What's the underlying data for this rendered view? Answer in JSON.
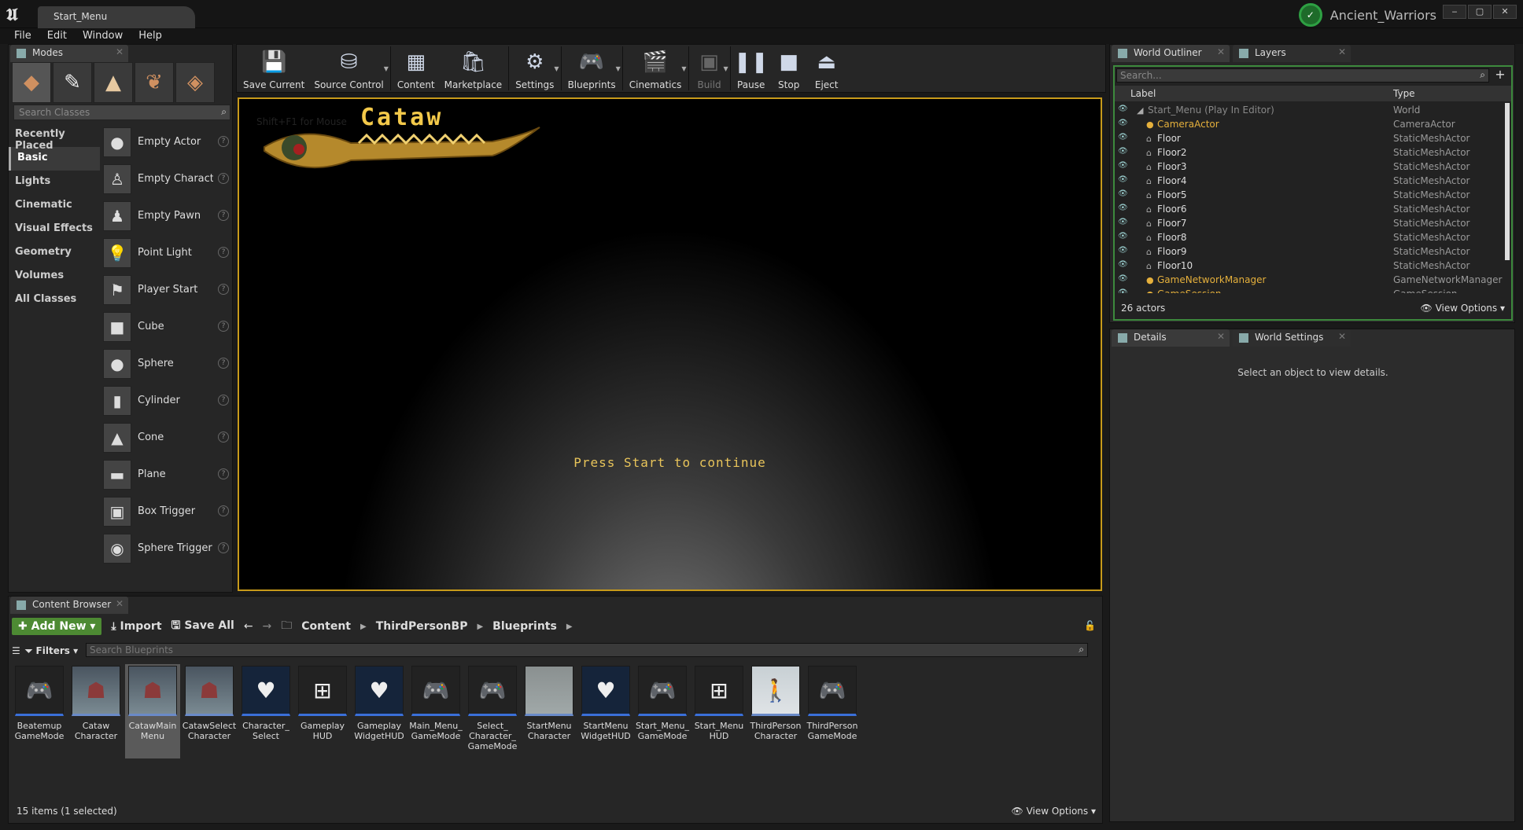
{
  "window": {
    "tab": "Start_Menu",
    "project": "Ancient_Warriors",
    "buttons": [
      "‒",
      "▢",
      "✕"
    ]
  },
  "menu": [
    "File",
    "Edit",
    "Window",
    "Help"
  ],
  "modes": {
    "tab": "Modes",
    "search_placeholder": "Search Classes",
    "categories": [
      "Recently Placed",
      "Basic",
      "Lights",
      "Cinematic",
      "Visual Effects",
      "Geometry",
      "Volumes",
      "All Classes"
    ],
    "active_category": "Basic",
    "classes": [
      {
        "label": "Empty Actor",
        "icon": "sphere-icon"
      },
      {
        "label": "Empty Characte",
        "icon": "character-icon"
      },
      {
        "label": "Empty Pawn",
        "icon": "pawn-icon"
      },
      {
        "label": "Point Light",
        "icon": "bulb-icon"
      },
      {
        "label": "Player Start",
        "icon": "player-start-icon"
      },
      {
        "label": "Cube",
        "icon": "cube-icon"
      },
      {
        "label": "Sphere",
        "icon": "sphere-icon"
      },
      {
        "label": "Cylinder",
        "icon": "cylinder-icon"
      },
      {
        "label": "Cone",
        "icon": "cone-icon"
      },
      {
        "label": "Plane",
        "icon": "plane-icon"
      },
      {
        "label": "Box Trigger",
        "icon": "box-trigger-icon"
      },
      {
        "label": "Sphere Trigger",
        "icon": "sphere-trigger-icon"
      }
    ]
  },
  "toolbar": [
    {
      "label": "Save Current",
      "icon": "save-icon",
      "glyph": "💾"
    },
    {
      "label": "Source Control",
      "icon": "source-control-icon",
      "glyph": "⛁",
      "dropdown": true
    },
    {
      "label": "Content",
      "icon": "content-icon",
      "glyph": "▦"
    },
    {
      "label": "Marketplace",
      "icon": "marketplace-icon",
      "glyph": "🛍"
    },
    {
      "label": "Settings",
      "icon": "settings-icon",
      "glyph": "⚙",
      "dropdown": true
    },
    {
      "label": "Blueprints",
      "icon": "blueprints-icon",
      "glyph": "🎮",
      "dropdown": true
    },
    {
      "label": "Cinematics",
      "icon": "cinematics-icon",
      "glyph": "🎬",
      "dropdown": true
    },
    {
      "label": "Build",
      "icon": "build-icon",
      "glyph": "▣",
      "dropdown": true,
      "disabled": true
    },
    {
      "label": "Pause",
      "icon": "pause-icon",
      "glyph": "❚❚"
    },
    {
      "label": "Stop",
      "icon": "stop-icon",
      "glyph": "■"
    },
    {
      "label": "Eject",
      "icon": "eject-icon",
      "glyph": "⏏"
    }
  ],
  "viewport": {
    "logo_text": "Cataw",
    "hint": "Shift+F1 for Mouse",
    "prompt": "Press Start to continue"
  },
  "outliner": {
    "tab": "World Outliner",
    "tab2": "Layers",
    "search_placeholder": "Search...",
    "col_label": "Label",
    "col_type": "Type",
    "rows": [
      {
        "label": "Start_Menu (Play In Editor)",
        "type": "World",
        "style": "dim"
      },
      {
        "label": "CameraActor",
        "type": "CameraActor",
        "style": "hl"
      },
      {
        "label": "Floor",
        "type": "StaticMeshActor",
        "style": ""
      },
      {
        "label": "Floor2",
        "type": "StaticMeshActor",
        "style": ""
      },
      {
        "label": "Floor3",
        "type": "StaticMeshActor",
        "style": ""
      },
      {
        "label": "Floor4",
        "type": "StaticMeshActor",
        "style": ""
      },
      {
        "label": "Floor5",
        "type": "StaticMeshActor",
        "style": ""
      },
      {
        "label": "Floor6",
        "type": "StaticMeshActor",
        "style": ""
      },
      {
        "label": "Floor7",
        "type": "StaticMeshActor",
        "style": ""
      },
      {
        "label": "Floor8",
        "type": "StaticMeshActor",
        "style": ""
      },
      {
        "label": "Floor9",
        "type": "StaticMeshActor",
        "style": ""
      },
      {
        "label": "Floor10",
        "type": "StaticMeshActor",
        "style": ""
      },
      {
        "label": "GameNetworkManager",
        "type": "GameNetworkManager",
        "style": "hl"
      },
      {
        "label": "GameSession",
        "type": "GameSession",
        "style": "hl"
      }
    ],
    "count": "26 actors",
    "view_options": "View Options"
  },
  "details": {
    "tab": "Details",
    "tab2": "World Settings",
    "message": "Select an object to view details."
  },
  "content_browser": {
    "tab": "Content Browser",
    "add_new": "Add New",
    "import": "Import",
    "save_all": "Save All",
    "path": [
      "Content",
      "ThirdPersonBP",
      "Blueprints"
    ],
    "filters": "Filters",
    "search_placeholder": "Search Blueprints",
    "assets": [
      {
        "name": "Beatemup GameMode",
        "kind": "gamemode",
        "glyph": "🎮"
      },
      {
        "name": "Cataw Character",
        "kind": "character",
        "glyph": "☗"
      },
      {
        "name": "CatawMain Menu",
        "kind": "character",
        "glyph": "☗",
        "selected": true
      },
      {
        "name": "CatawSelect Character",
        "kind": "character",
        "glyph": "☗"
      },
      {
        "name": "Character_ Select",
        "kind": "widget",
        "glyph": "♥"
      },
      {
        "name": "Gameplay HUD",
        "kind": "hud",
        "glyph": "⊞"
      },
      {
        "name": "Gameplay WidgetHUD",
        "kind": "widget",
        "glyph": "♥"
      },
      {
        "name": "Main_Menu_ GameMode",
        "kind": "gamemode",
        "glyph": "🎮"
      },
      {
        "name": "Select_ Character_ GameMode",
        "kind": "gamemode",
        "glyph": "🎮"
      },
      {
        "name": "StartMenu Character",
        "kind": "plain",
        "glyph": ""
      },
      {
        "name": "StartMenu WidgetHUD",
        "kind": "widget",
        "glyph": "♥"
      },
      {
        "name": "Start_Menu_ GameMode",
        "kind": "gamemode",
        "glyph": "🎮"
      },
      {
        "name": "Start_Menu HUD",
        "kind": "hud",
        "glyph": "⊞"
      },
      {
        "name": "ThirdPerson Character",
        "kind": "light",
        "glyph": "🚶"
      },
      {
        "name": "ThirdPerson GameMode",
        "kind": "gamemode",
        "glyph": "🎮"
      }
    ],
    "count": "15 items (1 selected)",
    "view_options": "View Options"
  }
}
